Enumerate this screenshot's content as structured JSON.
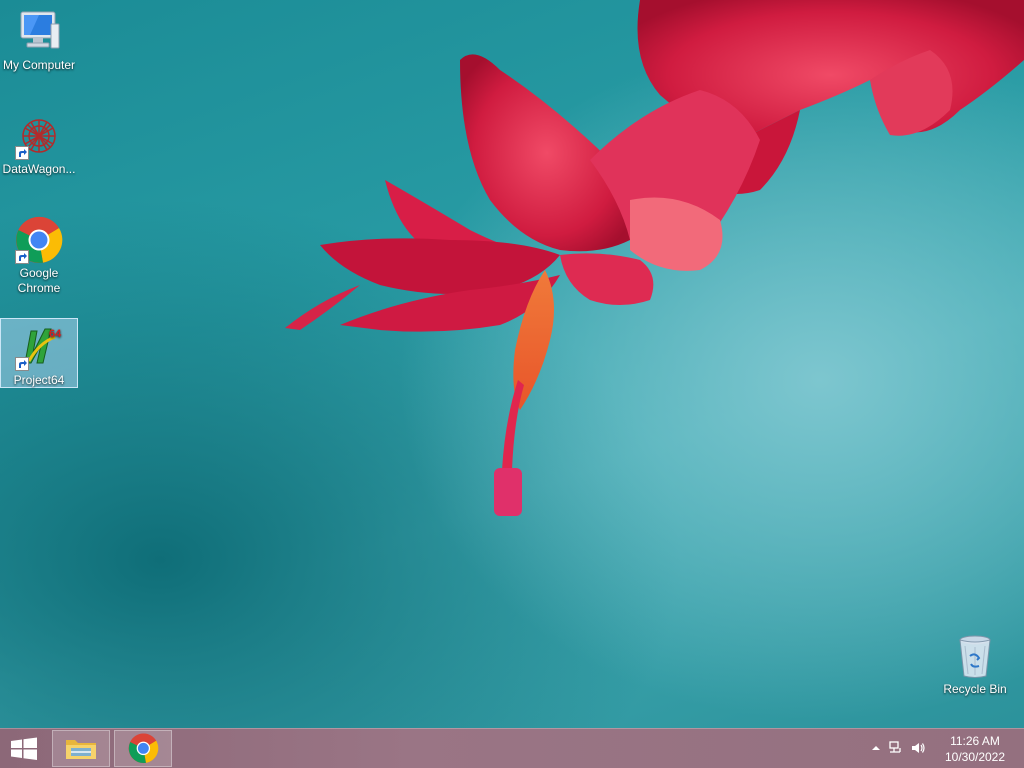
{
  "desktop": {
    "icons": [
      {
        "label": "My Computer",
        "icon": "computer-icon",
        "selected": false
      },
      {
        "label": "DataWagon...",
        "icon": "datawagon-icon",
        "selected": false
      },
      {
        "label": "Google Chrome",
        "icon": "chrome-icon",
        "selected": false
      },
      {
        "label": "Project64",
        "icon": "project64-icon",
        "selected": true
      }
    ],
    "recycle_bin": {
      "label": "Recycle Bin",
      "icon": "recycle-bin-icon"
    }
  },
  "taskbar": {
    "start_icon": "windows-logo-icon",
    "pinned": [
      {
        "app": "File Explorer",
        "icon": "folder-icon"
      },
      {
        "app": "Google Chrome",
        "icon": "chrome-icon"
      }
    ],
    "tray": {
      "overflow_icon": "chevron-up-icon",
      "network_icon": "network-icon",
      "volume_icon": "speaker-icon"
    },
    "clock": {
      "time": "11:26 AM",
      "date": "10/30/2022"
    }
  },
  "colors": {
    "wallpaper_teal": "#279aa3",
    "flower_red": "#d41f44",
    "taskbar": "#9a7585"
  }
}
